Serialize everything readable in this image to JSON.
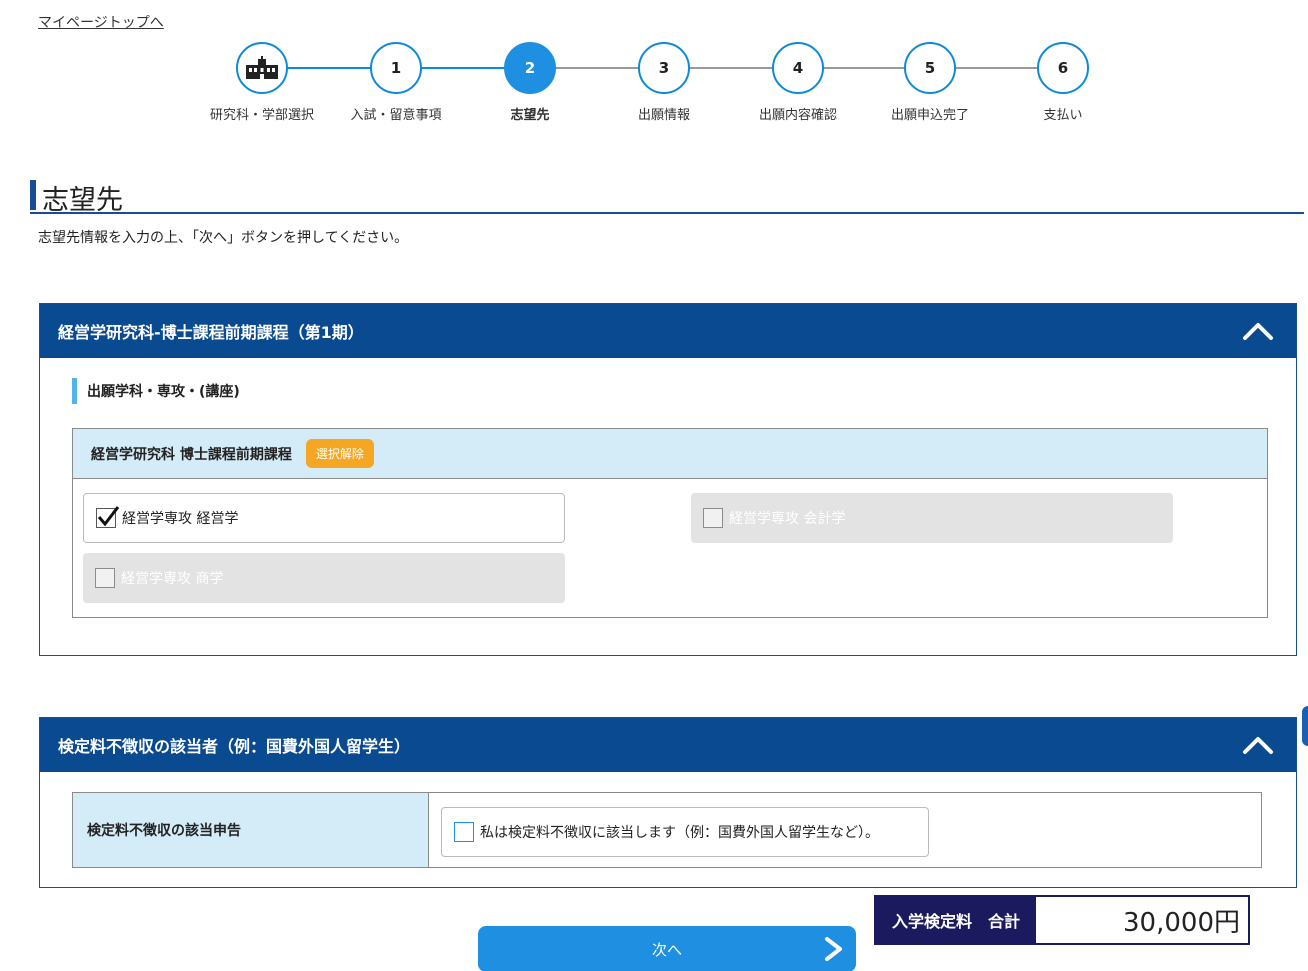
{
  "top_link": "マイページトップへ",
  "steps": [
    {
      "num": "",
      "label": "研究科・学部選択",
      "icon": "school-building-icon"
    },
    {
      "num": "1",
      "label": "入試・留意事項"
    },
    {
      "num": "2",
      "label": "志望先"
    },
    {
      "num": "3",
      "label": "出願情報"
    },
    {
      "num": "4",
      "label": "出願内容確認"
    },
    {
      "num": "5",
      "label": "出願申込完了"
    },
    {
      "num": "6",
      "label": "支払い"
    }
  ],
  "current_step": 2,
  "page_title": "志望先",
  "description": "志望先情報を入力の上、「次へ」ボタンを押してください。",
  "panel1": {
    "title": "経営学研究科-博士課程前期課程（第1期）",
    "sub_heading": "出願学科・専攻・(講座)",
    "course_title": "経営学研究科 博士課程前期課程",
    "clear_label": "選択解除",
    "options": [
      {
        "label": "経営学専攻 経営学",
        "checked": true,
        "enabled": true
      },
      {
        "label": "経営学専攻 会計学",
        "checked": false,
        "enabled": false
      },
      {
        "label": "経営学専攻 商学",
        "checked": false,
        "enabled": false
      }
    ]
  },
  "panel2": {
    "title": "検定料不徴収の該当者（例：国費外国人留学生）",
    "row_label": "検定料不徴収の該当申告",
    "checkbox_label": "私は検定料不徴収に該当します（例：国費外国人留学生など）。",
    "checked": false
  },
  "total": {
    "label": "入学検定料　合計",
    "value": "30,000円"
  },
  "next_label": "次へ",
  "colors": {
    "primary": "#0a4a91",
    "accent": "#1e8fe1",
    "badge": "#f5a623",
    "light_blue": "#d4ebf8",
    "total_dark": "#1c1a5e"
  }
}
